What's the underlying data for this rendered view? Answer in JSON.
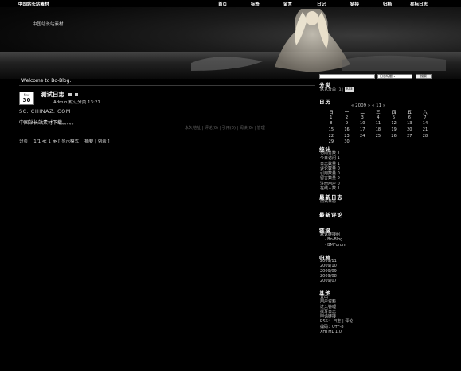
{
  "site": {
    "name": "中国站长站素材"
  },
  "nav": {
    "items": [
      "首页",
      "标签",
      "留言",
      "日记",
      "链接",
      "归档",
      "星标日志"
    ]
  },
  "header": {
    "subtitle": "中国站长站素材"
  },
  "welcome": "Welcome to Bo-Blog.",
  "post": {
    "month": "Nov",
    "day": "30",
    "title": "测试日志",
    "meta": "Admin  默认分类  13:21",
    "source": "SC. CHINAZ. COM",
    "body": "中国站长站素材下载。。。。。",
    "footer": "永久地址 | 评论(0) | 引用(0) | 阅读(0) | 管理"
  },
  "pager": "分页：  1/1  ≪  1  ≫  [ 显示模式：  摘要  |  列表 ]",
  "sidebar": {
    "search_select": "日志标题",
    "search_button": "搜索",
    "category_title": "分类",
    "category_item": "默认分类 [1]",
    "category_button": "RSS",
    "calendar_title": "日历",
    "calendar_header": "« 2009 »  « 11 »",
    "weekdays": [
      "日",
      "一",
      "二",
      "三",
      "四",
      "五",
      "六"
    ],
    "days": [
      "1",
      "2",
      "3",
      "4",
      "5",
      "6",
      "7",
      "8",
      "9",
      "10",
      "11",
      "12",
      "13",
      "14",
      "15",
      "16",
      "17",
      "18",
      "19",
      "20",
      "21",
      "22",
      "23",
      "24",
      "25",
      "26",
      "27",
      "28",
      "29",
      "30"
    ],
    "stats_title": "统计",
    "stats": [
      "访问总数  1",
      "今日访问  1",
      "日志数量  1",
      "评论数量  0",
      "引用数量  0",
      "留言数量  0",
      "注册用户  0",
      "在线人数  1"
    ],
    "latest_title": "最新日志",
    "latest": [
      "测试日志"
    ],
    "comments_title": "最新评论",
    "links_title": "链接",
    "links": [
      "默认链接组",
      "· Bo-Blog",
      "· BMForum"
    ],
    "archive_title": "归档",
    "archives": [
      "2009/11",
      "2009/10",
      "2009/09",
      "2009/08",
      "2009/07"
    ],
    "other_title": "其他",
    "others": [
      "登出",
      "用户资料",
      "进入管理",
      "撰写日志",
      "申请链接",
      "RSS：  日志 | 评论",
      "编码：UTF-8",
      "XHTML 1.0"
    ]
  }
}
